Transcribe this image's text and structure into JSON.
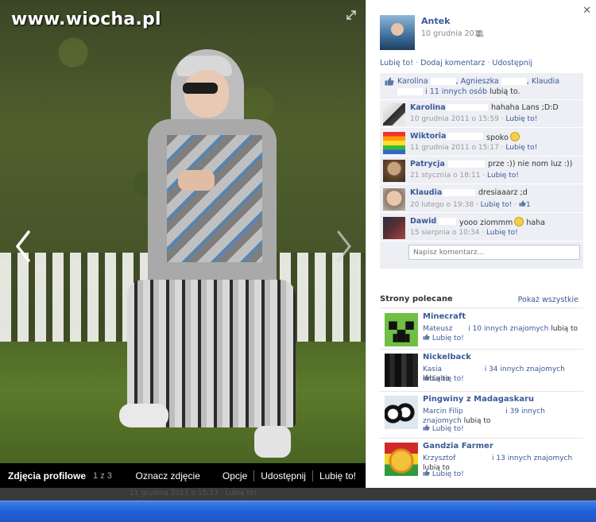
{
  "watermark": "www.wiocha.pl",
  "viewer": {
    "album_name": "Zdjęcia profilowe",
    "album_position": "1 z 3",
    "actions": [
      "Oznacz zdjęcie",
      "Opcje",
      "Udostępnij",
      "Lubię to!"
    ]
  },
  "post": {
    "owner_name": "Antek",
    "date": "10 grudnia 2011",
    "actions": {
      "like": "Lubię to!",
      "comment": "Dodaj komentarz",
      "share": "Udostępnij",
      "dot": "·"
    },
    "likes": {
      "names": [
        "Karolina",
        "Agnieszka",
        "Klaudia"
      ],
      "others": "i 11 innych osób",
      "suffix": "lubią to."
    }
  },
  "comments": [
    {
      "name": "Karolina",
      "text": "hahaha Lans ;D:D",
      "date": "10 grudnia 2011 o 15:59",
      "like": "Lubię to!",
      "likes_count": ""
    },
    {
      "name": "Wiktoria",
      "text": "spoko",
      "date": "11 grudnia 2011 o 15:17",
      "like": "Lubię to!",
      "likes_count": ""
    },
    {
      "name": "Patrycja",
      "text": "prze :)) nie nom luz :))",
      "date": "21 stycznia o 18:11",
      "like": "Lubię to!",
      "likes_count": ""
    },
    {
      "name": "Klaudia",
      "text": "dresiaaarz ;d",
      "date": "20 lutego o 19:38",
      "like": "Lubię to!",
      "likes_count": "1"
    },
    {
      "name": "Dawid",
      "text": "yooo ziommm",
      "text2": "haha",
      "date": "15 sierpnia o 10:34",
      "like": "Lubię to!",
      "likes_count": ""
    }
  ],
  "comment_input": {
    "placeholder": "Napisz komentarz..."
  },
  "recommended": {
    "title": "Strony polecane",
    "show_all": "Pokaż wszystkie",
    "items": [
      {
        "name": "Minecraft",
        "friend": "Mateusz",
        "others": "i 10 innych znajomych",
        "suffix": "lubią to",
        "like": "Lubię to!"
      },
      {
        "name": "Nickelback",
        "friend": "Kasia",
        "others": "i 34 innych znajomych",
        "suffix": "lubią to",
        "like": "Lubię to!"
      },
      {
        "name": "Pingwiny z Madagaskaru",
        "friend": "Marcin Filip",
        "others": "i 39 innych znajomych",
        "suffix": "lubią to",
        "like": "Lubię to!"
      },
      {
        "name": "Gandzia Farmer",
        "friend": "Krzysztof",
        "others": "i 13 innych znajomych",
        "suffix": "lubią to",
        "like": "Lubię to!"
      }
    ]
  },
  "under_strip": {
    "text": "11 grudnia 2011 o 15:17 · Lubię to!"
  },
  "colors": {
    "link": "#3b5998",
    "comments_bg": "#edeff4",
    "taskbar": "#2256c8"
  }
}
